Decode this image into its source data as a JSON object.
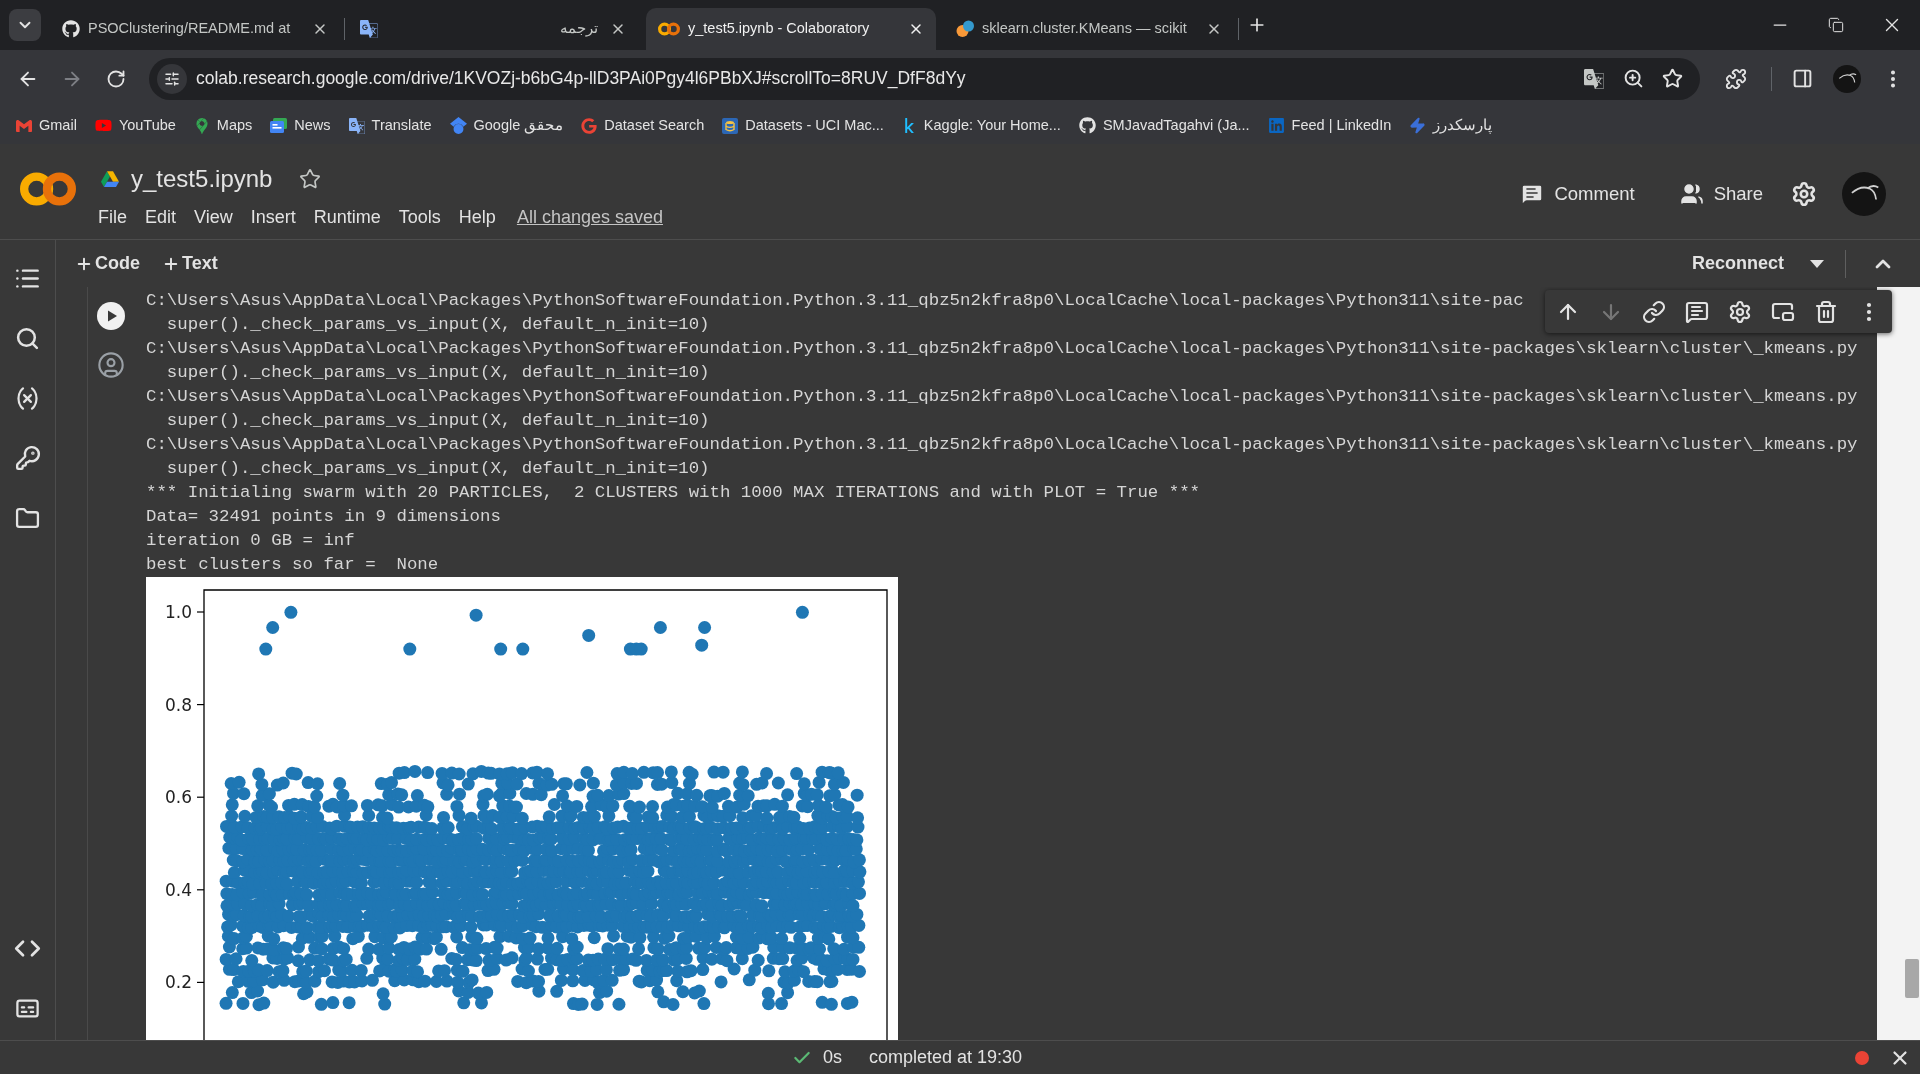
{
  "browser": {
    "tabs": [
      {
        "title": "PSOClustering/README.md at",
        "selected": false
      },
      {
        "title": "ترجمه",
        "selected": false
      },
      {
        "title": "y_test5.ipynb - Colaboratory",
        "selected": true
      },
      {
        "title": "sklearn.cluster.KMeans — scikit",
        "selected": false
      }
    ],
    "address": "colab.research.google.com/drive/1KVOZj-b6bG4p-llD3PAi0Pgy4l6PBbXJ#scrollTo=8RUV_DfF8dYy",
    "bookmarks": [
      "Gmail",
      "YouTube",
      "Maps",
      "News",
      "Translate",
      "Google محقق",
      "Dataset Search",
      "Datasets - UCI Mac...",
      "Kaggle: Your Home...",
      "SMJavadTagahvi (Ja...",
      "Feed | LinkedIn",
      "پارسکدرز"
    ]
  },
  "notebook": {
    "title": "y_test5.ipynb",
    "menu": [
      "File",
      "Edit",
      "View",
      "Insert",
      "Runtime",
      "Tools",
      "Help"
    ],
    "save_status": "All changes saved",
    "header_actions": [
      "Comment",
      "Share"
    ]
  },
  "toolbar": {
    "add_buttons": [
      "Code",
      "Text"
    ],
    "connect_button": "Reconnect"
  },
  "cell_toolbar": [
    {
      "disabled": false
    },
    {
      "disabled": true
    },
    {
      "disabled": false
    },
    {
      "disabled": false
    },
    {
      "disabled": false
    },
    {
      "disabled": false
    },
    {
      "disabled": false
    },
    {
      "disabled": false
    }
  ],
  "output": {
    "lines": [
      "C:\\Users\\Asus\\AppData\\Local\\Packages\\PythonSoftwareFoundation.Python.3.11_qbz5n2kfra8p0\\LocalCache\\local-packages\\Python311\\site-pac",
      "  super()._check_params_vs_input(X, default_n_init=10)",
      "C:\\Users\\Asus\\AppData\\Local\\Packages\\PythonSoftwareFoundation.Python.3.11_qbz5n2kfra8p0\\LocalCache\\local-packages\\Python311\\site-packages\\sklearn\\cluster\\_kmeans.py",
      "  super()._check_params_vs_input(X, default_n_init=10)",
      "C:\\Users\\Asus\\AppData\\Local\\Packages\\PythonSoftwareFoundation.Python.3.11_qbz5n2kfra8p0\\LocalCache\\local-packages\\Python311\\site-packages\\sklearn\\cluster\\_kmeans.py",
      "  super()._check_params_vs_input(X, default_n_init=10)",
      "C:\\Users\\Asus\\AppData\\Local\\Packages\\PythonSoftwareFoundation.Python.3.11_qbz5n2kfra8p0\\LocalCache\\local-packages\\Python311\\site-packages\\sklearn\\cluster\\_kmeans.py",
      "  super()._check_params_vs_input(X, default_n_init=10)",
      "*** Initialing swarm with 20 PARTICLES,  2 CLUSTERS with 1000 MAX ITERATIONS and with PLOT = True ***",
      "Data= 32491 points in 9 dimensions",
      "iteration 0 GB = inf",
      "best clusters so far =  None"
    ],
    "plot": {
      "y_tick_labels": [
        "1.0",
        "0.8",
        "0.6",
        "0.4",
        "0.2"
      ]
    }
  },
  "status_bar": {
    "duration": "0s",
    "message": "completed at 19:30"
  }
}
